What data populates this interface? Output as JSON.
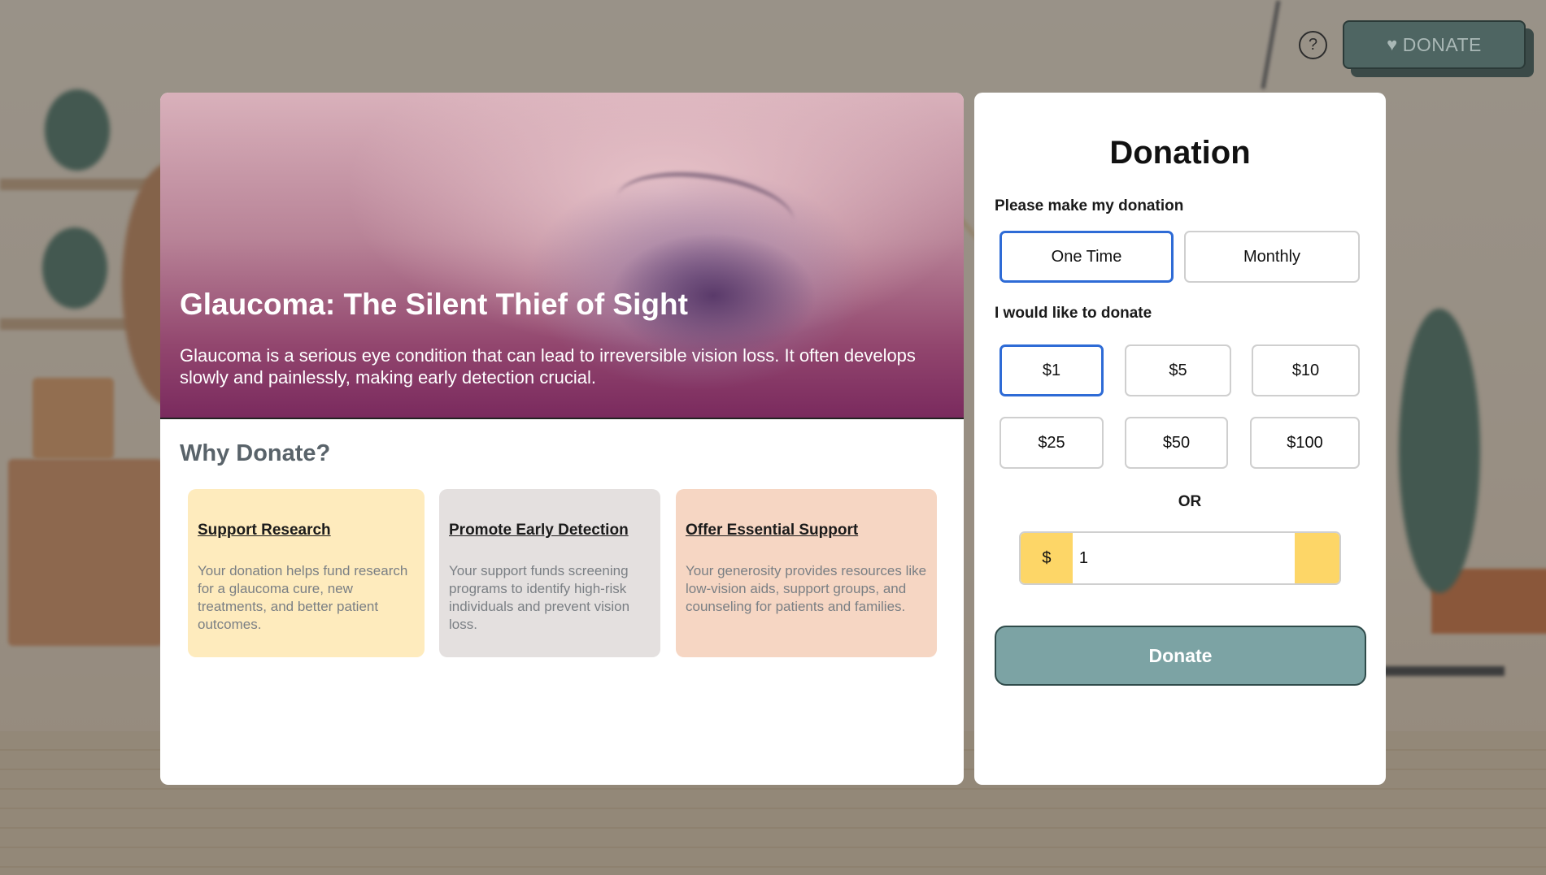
{
  "header": {
    "help_icon": "question-circle-icon",
    "help_label": "?",
    "donate_icon": "heart-icon",
    "donate_label": "DONATE"
  },
  "hero": {
    "title": "Glaucoma: The Silent Thief of Sight",
    "subtitle": "Glaucoma is a serious eye condition that can lead to irreversible vision loss. It often develops slowly and painlessly, making early detection crucial."
  },
  "why": {
    "title": "Why Donate?",
    "reasons": [
      {
        "title": "Support Research",
        "body": "Your donation helps fund research for a glaucoma cure, new treatments, and better patient outcomes.",
        "color": "#feebbd"
      },
      {
        "title": "Promote Early Detection",
        "body": "Your support funds screening programs to identify high-risk individuals and prevent vision loss.",
        "color": "#e4e0df"
      },
      {
        "title": "Offer Essential Support",
        "body": "Your generosity provides resources like low-vision aids, support groups, and counseling for patients and families.",
        "color": "#f6d6c3"
      }
    ]
  },
  "donation": {
    "title": "Donation",
    "frequency_label": "Please make my donation",
    "frequency_options": [
      "One Time",
      "Monthly"
    ],
    "frequency_selected": "One Time",
    "amount_label": "I would like to donate",
    "amounts": [
      "$1",
      "$5",
      "$10",
      "$25",
      "$50",
      "$100"
    ],
    "amount_selected": "$1",
    "or_label": "OR",
    "currency_symbol": "$",
    "custom_amount": "1",
    "submit_label": "Donate",
    "accent_color": "#2e6bd6",
    "button_color": "#7ca3a4",
    "highlight_color": "#fdd667"
  }
}
